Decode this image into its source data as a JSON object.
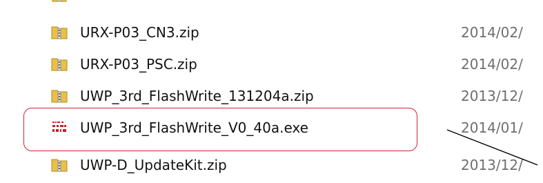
{
  "cut_row": {
    "name": "",
    "date": ""
  },
  "files": [
    {
      "name": "URX-P03_CN3.zip",
      "date": "2014/02/",
      "icon": "zip-folder-icon"
    },
    {
      "name": "URX-P03_PSC.zip",
      "date": "2014/02/",
      "icon": "zip-folder-icon"
    },
    {
      "name": "UWP_3rd_FlashWrite_131204a.zip",
      "date": "2013/12/",
      "icon": "zip-folder-icon"
    },
    {
      "name": "UWP_3rd_FlashWrite_V0_40a.exe",
      "date": "2014/01/",
      "icon": "exe-icon"
    },
    {
      "name": "UWP-D_UpdateKit.zip",
      "date": "2013/12/",
      "icon": "zip-folder-icon"
    }
  ],
  "colors": {
    "highlight": "#d6202f",
    "zip_folder": "#e9c14a",
    "exe_icon": "#d11a2a",
    "date_text": "#6e6e6e"
  }
}
